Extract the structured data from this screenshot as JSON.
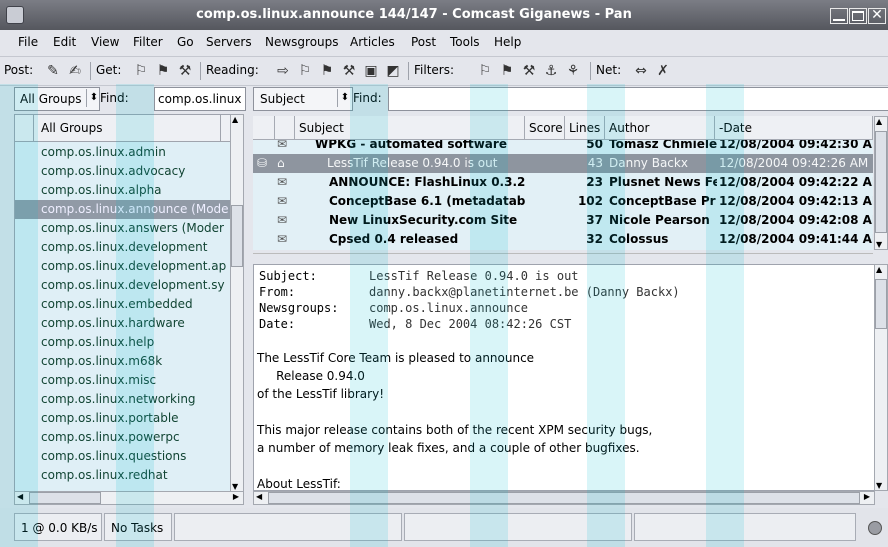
{
  "window": {
    "title": "comp.os.linux.announce 144/147 -  Comcast Giganews - Pan"
  },
  "menu": [
    {
      "label": "File"
    },
    {
      "label": "Edit"
    },
    {
      "label": "View"
    },
    {
      "label": "Filter"
    },
    {
      "label": "Go"
    },
    {
      "label": "Servers"
    },
    {
      "label": "Newsgroups"
    },
    {
      "label": "Articles"
    },
    {
      "label": "Post"
    },
    {
      "label": "Tools"
    },
    {
      "label": "Help"
    }
  ],
  "toolbar": {
    "post_label": "Post:",
    "get_label": "Get:",
    "reading_label": "Reading:",
    "filters_label": "Filters:",
    "net_label": "Net:"
  },
  "groups": {
    "scope_value": "All Groups",
    "find_label": "Find:",
    "find_value": "comp.os.linux",
    "header": "All Groups",
    "items": [
      {
        "name": "comp.os.linux.admin"
      },
      {
        "name": "comp.os.linux.advocacy"
      },
      {
        "name": "comp.os.linux.alpha"
      },
      {
        "name": "comp.os.linux.announce (Mode"
      },
      {
        "name": "comp.os.linux.answers (Moder"
      },
      {
        "name": "comp.os.linux.development"
      },
      {
        "name": "comp.os.linux.development.ap"
      },
      {
        "name": "comp.os.linux.development.sy"
      },
      {
        "name": "comp.os.linux.embedded"
      },
      {
        "name": "comp.os.linux.hardware"
      },
      {
        "name": "comp.os.linux.help"
      },
      {
        "name": "comp.os.linux.m68k"
      },
      {
        "name": "comp.os.linux.misc"
      },
      {
        "name": "comp.os.linux.networking"
      },
      {
        "name": "comp.os.linux.portable"
      },
      {
        "name": "comp.os.linux.powerpc"
      },
      {
        "name": "comp.os.linux.questions"
      },
      {
        "name": "comp.os.linux.redhat"
      }
    ]
  },
  "articles": {
    "filter_value": "Subject",
    "find_label": "Find:",
    "find_value": "",
    "columns": {
      "subject": "Subject",
      "score": "Score",
      "lines": "Lines",
      "author": "Author",
      "date": "-Date"
    },
    "rows": [
      {
        "subject": "WPKG - automated software",
        "score": "",
        "lines": "50",
        "author": "Tomasz Chmiele",
        "date": "12/08/2004 09:42:30 AI"
      },
      {
        "subject": "LessTif Release 0.94.0 is out",
        "score": "",
        "lines": "43",
        "author": "Danny Backx",
        "date": "12/08/2004 09:42:26 AM"
      },
      {
        "subject": "ANNOUNCE: FlashLinux 0.3.2",
        "score": "",
        "lines": "23",
        "author": "Plusnet News Fe",
        "date": "12/08/2004 09:42:22 AI"
      },
      {
        "subject": "ConceptBase 6.1 (metadatab",
        "score": "",
        "lines": "102",
        "author": "ConceptBase Pr",
        "date": "12/08/2004 09:42:13 AI"
      },
      {
        "subject": "New LinuxSecurity.com Site",
        "score": "",
        "lines": "37",
        "author": "Nicole Pearson",
        "date": "12/08/2004 09:42:08 AI"
      },
      {
        "subject": "Cpsed 0.4 released",
        "score": "",
        "lines": "32",
        "author": "Colossus",
        "date": "12/08/2004 09:41:44 AI"
      }
    ]
  },
  "article": {
    "headers": [
      {
        "key": "Subject:",
        "value": "LessTif Release 0.94.0 is out"
      },
      {
        "key": "From:",
        "value": "danny.backx@planetinternet.be (Danny Backx)"
      },
      {
        "key": "Newsgroups:",
        "value": "comp.os.linux.announce"
      },
      {
        "key": "Date:",
        "value": "Wed, 8 Dec 2004 08:42:26 CST"
      }
    ],
    "body": [
      "The LessTif Core Team is pleased to announce",
      "     Release 0.94.0",
      "of the LessTif library!",
      "",
      "This major release contains both of the recent XPM security bugs,",
      "a number of memory leak fixes, and a couple of other bugfixes.",
      "",
      "About LessTif:"
    ]
  },
  "status": {
    "rate": "1 @ 0.0 KB/s",
    "tasks": "No Tasks"
  }
}
